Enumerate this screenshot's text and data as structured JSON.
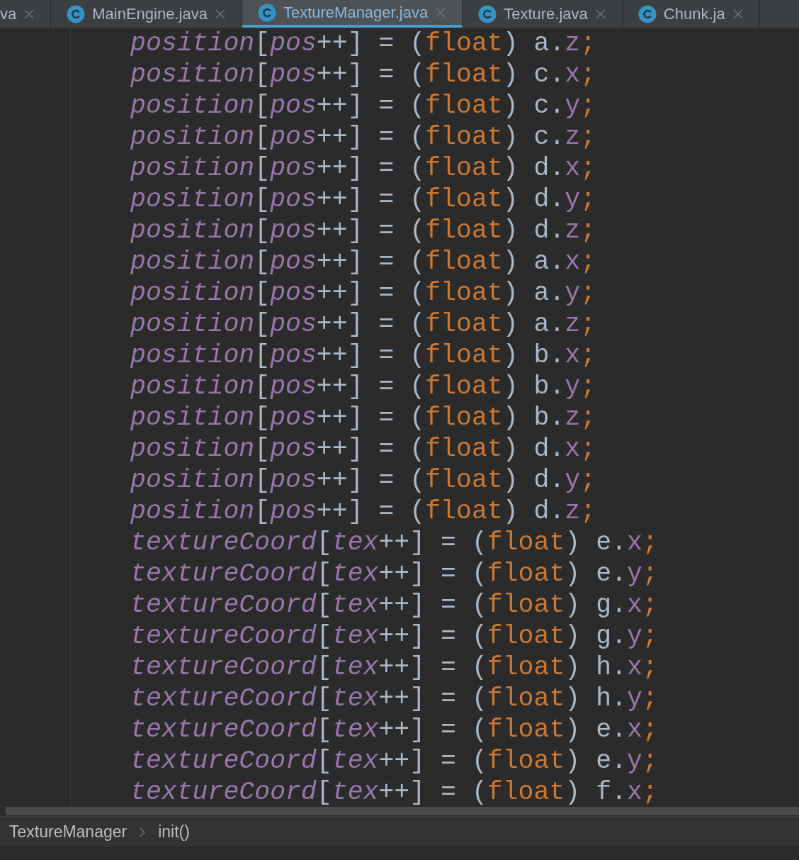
{
  "tabs": [
    {
      "label": "va",
      "selected": false,
      "icon": false
    },
    {
      "label": "MainEngine.java",
      "selected": false,
      "icon": true
    },
    {
      "label": "TextureManager.java",
      "selected": true,
      "icon": true
    },
    {
      "label": "Texture.java",
      "selected": false,
      "icon": true
    },
    {
      "label": "Chunk.ja",
      "selected": false,
      "icon": true
    }
  ],
  "code_lines": [
    [
      {
        "kind": "ital",
        "text": "position"
      },
      {
        "kind": "plain",
        "text": "["
      },
      {
        "kind": "ital",
        "text": "pos"
      },
      {
        "kind": "plain",
        "text": "++] = ("
      },
      {
        "kind": "kw",
        "text": "float"
      },
      {
        "kind": "plain",
        "text": ") a."
      },
      {
        "kind": "member",
        "text": "z"
      },
      {
        "kind": "kw",
        "text": ";"
      }
    ],
    [
      {
        "kind": "ital",
        "text": "position"
      },
      {
        "kind": "plain",
        "text": "["
      },
      {
        "kind": "ital",
        "text": "pos"
      },
      {
        "kind": "plain",
        "text": "++] = ("
      },
      {
        "kind": "kw",
        "text": "float"
      },
      {
        "kind": "plain",
        "text": ") c."
      },
      {
        "kind": "member",
        "text": "x"
      },
      {
        "kind": "kw",
        "text": ";"
      }
    ],
    [
      {
        "kind": "ital",
        "text": "position"
      },
      {
        "kind": "plain",
        "text": "["
      },
      {
        "kind": "ital",
        "text": "pos"
      },
      {
        "kind": "plain",
        "text": "++] = ("
      },
      {
        "kind": "kw",
        "text": "float"
      },
      {
        "kind": "plain",
        "text": ") c."
      },
      {
        "kind": "member",
        "text": "y"
      },
      {
        "kind": "kw",
        "text": ";"
      }
    ],
    [
      {
        "kind": "ital",
        "text": "position"
      },
      {
        "kind": "plain",
        "text": "["
      },
      {
        "kind": "ital",
        "text": "pos"
      },
      {
        "kind": "plain",
        "text": "++] = ("
      },
      {
        "kind": "kw",
        "text": "float"
      },
      {
        "kind": "plain",
        "text": ") c."
      },
      {
        "kind": "member",
        "text": "z"
      },
      {
        "kind": "kw",
        "text": ";"
      }
    ],
    [
      {
        "kind": "ital",
        "text": "position"
      },
      {
        "kind": "plain",
        "text": "["
      },
      {
        "kind": "ital",
        "text": "pos"
      },
      {
        "kind": "plain",
        "text": "++] = ("
      },
      {
        "kind": "kw",
        "text": "float"
      },
      {
        "kind": "plain",
        "text": ") d."
      },
      {
        "kind": "member",
        "text": "x"
      },
      {
        "kind": "kw",
        "text": ";"
      }
    ],
    [
      {
        "kind": "ital",
        "text": "position"
      },
      {
        "kind": "plain",
        "text": "["
      },
      {
        "kind": "ital",
        "text": "pos"
      },
      {
        "kind": "plain",
        "text": "++] = ("
      },
      {
        "kind": "kw",
        "text": "float"
      },
      {
        "kind": "plain",
        "text": ") d."
      },
      {
        "kind": "member",
        "text": "y"
      },
      {
        "kind": "kw",
        "text": ";"
      }
    ],
    [
      {
        "kind": "ital",
        "text": "position"
      },
      {
        "kind": "plain",
        "text": "["
      },
      {
        "kind": "ital",
        "text": "pos"
      },
      {
        "kind": "plain",
        "text": "++] = ("
      },
      {
        "kind": "kw",
        "text": "float"
      },
      {
        "kind": "plain",
        "text": ") d."
      },
      {
        "kind": "member",
        "text": "z"
      },
      {
        "kind": "kw",
        "text": ";"
      }
    ],
    [
      {
        "kind": "ital",
        "text": "position"
      },
      {
        "kind": "plain",
        "text": "["
      },
      {
        "kind": "ital",
        "text": "pos"
      },
      {
        "kind": "plain",
        "text": "++] = ("
      },
      {
        "kind": "kw",
        "text": "float"
      },
      {
        "kind": "plain",
        "text": ") a."
      },
      {
        "kind": "member",
        "text": "x"
      },
      {
        "kind": "kw",
        "text": ";"
      }
    ],
    [
      {
        "kind": "ital",
        "text": "position"
      },
      {
        "kind": "plain",
        "text": "["
      },
      {
        "kind": "ital",
        "text": "pos"
      },
      {
        "kind": "plain",
        "text": "++] = ("
      },
      {
        "kind": "kw",
        "text": "float"
      },
      {
        "kind": "plain",
        "text": ") a."
      },
      {
        "kind": "member",
        "text": "y"
      },
      {
        "kind": "kw",
        "text": ";"
      }
    ],
    [
      {
        "kind": "ital",
        "text": "position"
      },
      {
        "kind": "plain",
        "text": "["
      },
      {
        "kind": "ital",
        "text": "pos"
      },
      {
        "kind": "plain",
        "text": "++] = ("
      },
      {
        "kind": "kw",
        "text": "float"
      },
      {
        "kind": "plain",
        "text": ") a."
      },
      {
        "kind": "member",
        "text": "z"
      },
      {
        "kind": "kw",
        "text": ";"
      }
    ],
    [
      {
        "kind": "ital",
        "text": "position"
      },
      {
        "kind": "plain",
        "text": "["
      },
      {
        "kind": "ital",
        "text": "pos"
      },
      {
        "kind": "plain",
        "text": "++] = ("
      },
      {
        "kind": "kw",
        "text": "float"
      },
      {
        "kind": "plain",
        "text": ") b."
      },
      {
        "kind": "member",
        "text": "x"
      },
      {
        "kind": "kw",
        "text": ";"
      }
    ],
    [
      {
        "kind": "ital",
        "text": "position"
      },
      {
        "kind": "plain",
        "text": "["
      },
      {
        "kind": "ital",
        "text": "pos"
      },
      {
        "kind": "plain",
        "text": "++] = ("
      },
      {
        "kind": "kw",
        "text": "float"
      },
      {
        "kind": "plain",
        "text": ") b."
      },
      {
        "kind": "member",
        "text": "y"
      },
      {
        "kind": "kw",
        "text": ";"
      }
    ],
    [
      {
        "kind": "ital",
        "text": "position"
      },
      {
        "kind": "plain",
        "text": "["
      },
      {
        "kind": "ital",
        "text": "pos"
      },
      {
        "kind": "plain",
        "text": "++] = ("
      },
      {
        "kind": "kw",
        "text": "float"
      },
      {
        "kind": "plain",
        "text": ") b."
      },
      {
        "kind": "member",
        "text": "z"
      },
      {
        "kind": "kw",
        "text": ";"
      }
    ],
    [
      {
        "kind": "ital",
        "text": "position"
      },
      {
        "kind": "plain",
        "text": "["
      },
      {
        "kind": "ital",
        "text": "pos"
      },
      {
        "kind": "plain",
        "text": "++] = ("
      },
      {
        "kind": "kw",
        "text": "float"
      },
      {
        "kind": "plain",
        "text": ") d."
      },
      {
        "kind": "member",
        "text": "x"
      },
      {
        "kind": "kw",
        "text": ";"
      }
    ],
    [
      {
        "kind": "ital",
        "text": "position"
      },
      {
        "kind": "plain",
        "text": "["
      },
      {
        "kind": "ital",
        "text": "pos"
      },
      {
        "kind": "plain",
        "text": "++] = ("
      },
      {
        "kind": "kw",
        "text": "float"
      },
      {
        "kind": "plain",
        "text": ") d."
      },
      {
        "kind": "member",
        "text": "y"
      },
      {
        "kind": "kw",
        "text": ";"
      }
    ],
    [
      {
        "kind": "ital",
        "text": "position"
      },
      {
        "kind": "plain",
        "text": "["
      },
      {
        "kind": "ital",
        "text": "pos"
      },
      {
        "kind": "plain",
        "text": "++] = ("
      },
      {
        "kind": "kw",
        "text": "float"
      },
      {
        "kind": "plain",
        "text": ") d."
      },
      {
        "kind": "member",
        "text": "z"
      },
      {
        "kind": "kw",
        "text": ";"
      }
    ],
    [
      {
        "kind": "ital",
        "text": "textureCoord"
      },
      {
        "kind": "plain",
        "text": "["
      },
      {
        "kind": "ital",
        "text": "tex"
      },
      {
        "kind": "plain",
        "text": "++] = ("
      },
      {
        "kind": "kw",
        "text": "float"
      },
      {
        "kind": "plain",
        "text": ") e."
      },
      {
        "kind": "member",
        "text": "x"
      },
      {
        "kind": "kw",
        "text": ";"
      }
    ],
    [
      {
        "kind": "ital",
        "text": "textureCoord"
      },
      {
        "kind": "plain",
        "text": "["
      },
      {
        "kind": "ital",
        "text": "tex"
      },
      {
        "kind": "plain",
        "text": "++] = ("
      },
      {
        "kind": "kw",
        "text": "float"
      },
      {
        "kind": "plain",
        "text": ") e."
      },
      {
        "kind": "member",
        "text": "y"
      },
      {
        "kind": "kw",
        "text": ";"
      }
    ],
    [
      {
        "kind": "ital",
        "text": "textureCoord"
      },
      {
        "kind": "plain",
        "text": "["
      },
      {
        "kind": "ital",
        "text": "tex"
      },
      {
        "kind": "plain",
        "text": "++] = ("
      },
      {
        "kind": "kw",
        "text": "float"
      },
      {
        "kind": "plain",
        "text": ") g."
      },
      {
        "kind": "member",
        "text": "x"
      },
      {
        "kind": "kw",
        "text": ";"
      }
    ],
    [
      {
        "kind": "ital",
        "text": "textureCoord"
      },
      {
        "kind": "plain",
        "text": "["
      },
      {
        "kind": "ital",
        "text": "tex"
      },
      {
        "kind": "plain",
        "text": "++] = ("
      },
      {
        "kind": "kw",
        "text": "float"
      },
      {
        "kind": "plain",
        "text": ") g."
      },
      {
        "kind": "member",
        "text": "y"
      },
      {
        "kind": "kw",
        "text": ";"
      }
    ],
    [
      {
        "kind": "ital",
        "text": "textureCoord"
      },
      {
        "kind": "plain",
        "text": "["
      },
      {
        "kind": "ital",
        "text": "tex"
      },
      {
        "kind": "plain",
        "text": "++] = ("
      },
      {
        "kind": "kw",
        "text": "float"
      },
      {
        "kind": "plain",
        "text": ") h."
      },
      {
        "kind": "member",
        "text": "x"
      },
      {
        "kind": "kw",
        "text": ";"
      }
    ],
    [
      {
        "kind": "ital",
        "text": "textureCoord"
      },
      {
        "kind": "plain",
        "text": "["
      },
      {
        "kind": "ital",
        "text": "tex"
      },
      {
        "kind": "plain",
        "text": "++] = ("
      },
      {
        "kind": "kw",
        "text": "float"
      },
      {
        "kind": "plain",
        "text": ") h."
      },
      {
        "kind": "member",
        "text": "y"
      },
      {
        "kind": "kw",
        "text": ";"
      }
    ],
    [
      {
        "kind": "ital",
        "text": "textureCoord"
      },
      {
        "kind": "plain",
        "text": "["
      },
      {
        "kind": "ital",
        "text": "tex"
      },
      {
        "kind": "plain",
        "text": "++] = ("
      },
      {
        "kind": "kw",
        "text": "float"
      },
      {
        "kind": "plain",
        "text": ") e."
      },
      {
        "kind": "member",
        "text": "x"
      },
      {
        "kind": "kw",
        "text": ";"
      }
    ],
    [
      {
        "kind": "ital",
        "text": "textureCoord"
      },
      {
        "kind": "plain",
        "text": "["
      },
      {
        "kind": "ital",
        "text": "tex"
      },
      {
        "kind": "plain",
        "text": "++] = ("
      },
      {
        "kind": "kw",
        "text": "float"
      },
      {
        "kind": "plain",
        "text": ") e."
      },
      {
        "kind": "member",
        "text": "y"
      },
      {
        "kind": "kw",
        "text": ";"
      }
    ],
    [
      {
        "kind": "ital",
        "text": "textureCoord"
      },
      {
        "kind": "plain",
        "text": "["
      },
      {
        "kind": "ital",
        "text": "tex"
      },
      {
        "kind": "plain",
        "text": "++] = ("
      },
      {
        "kind": "kw",
        "text": "float"
      },
      {
        "kind": "plain",
        "text": ") f."
      },
      {
        "kind": "member",
        "text": "x"
      },
      {
        "kind": "kw",
        "text": ";"
      }
    ]
  ],
  "breadcrumb": [
    "TextureManager",
    "init()"
  ]
}
